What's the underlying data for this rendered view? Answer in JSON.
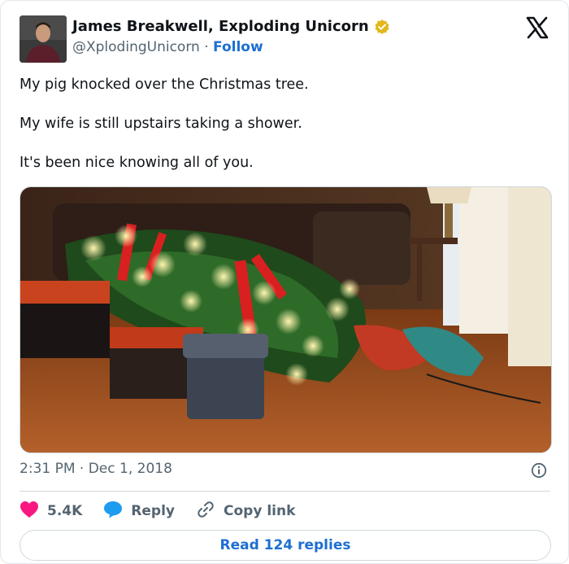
{
  "author": {
    "name": "James Breakwell, Exploding Unicorn",
    "handle": "@XplodingUnicorn",
    "separator": "·",
    "follow_label": "Follow"
  },
  "tweet": {
    "lines": [
      "My pig knocked over the Christmas tree.",
      "My wife is still upstairs taking a shower.",
      "It's been nice knowing all of you."
    ],
    "time": "2:31 PM",
    "date_separator": "·",
    "date": "Dec 1, 2018"
  },
  "actions": {
    "likes": "5.4K",
    "reply_label": "Reply",
    "copy_link_label": "Copy link"
  },
  "read_replies_label": "Read 124 replies",
  "icons": {
    "verified": "verified-badge-icon",
    "logo": "x-logo-icon",
    "info": "info-icon",
    "heart": "heart-icon",
    "reply": "reply-bubble-icon",
    "link": "link-icon"
  },
  "colors": {
    "accent": "#1d6fd1",
    "heart": "#f91880",
    "verified": "#e2b719",
    "muted": "#536471"
  }
}
